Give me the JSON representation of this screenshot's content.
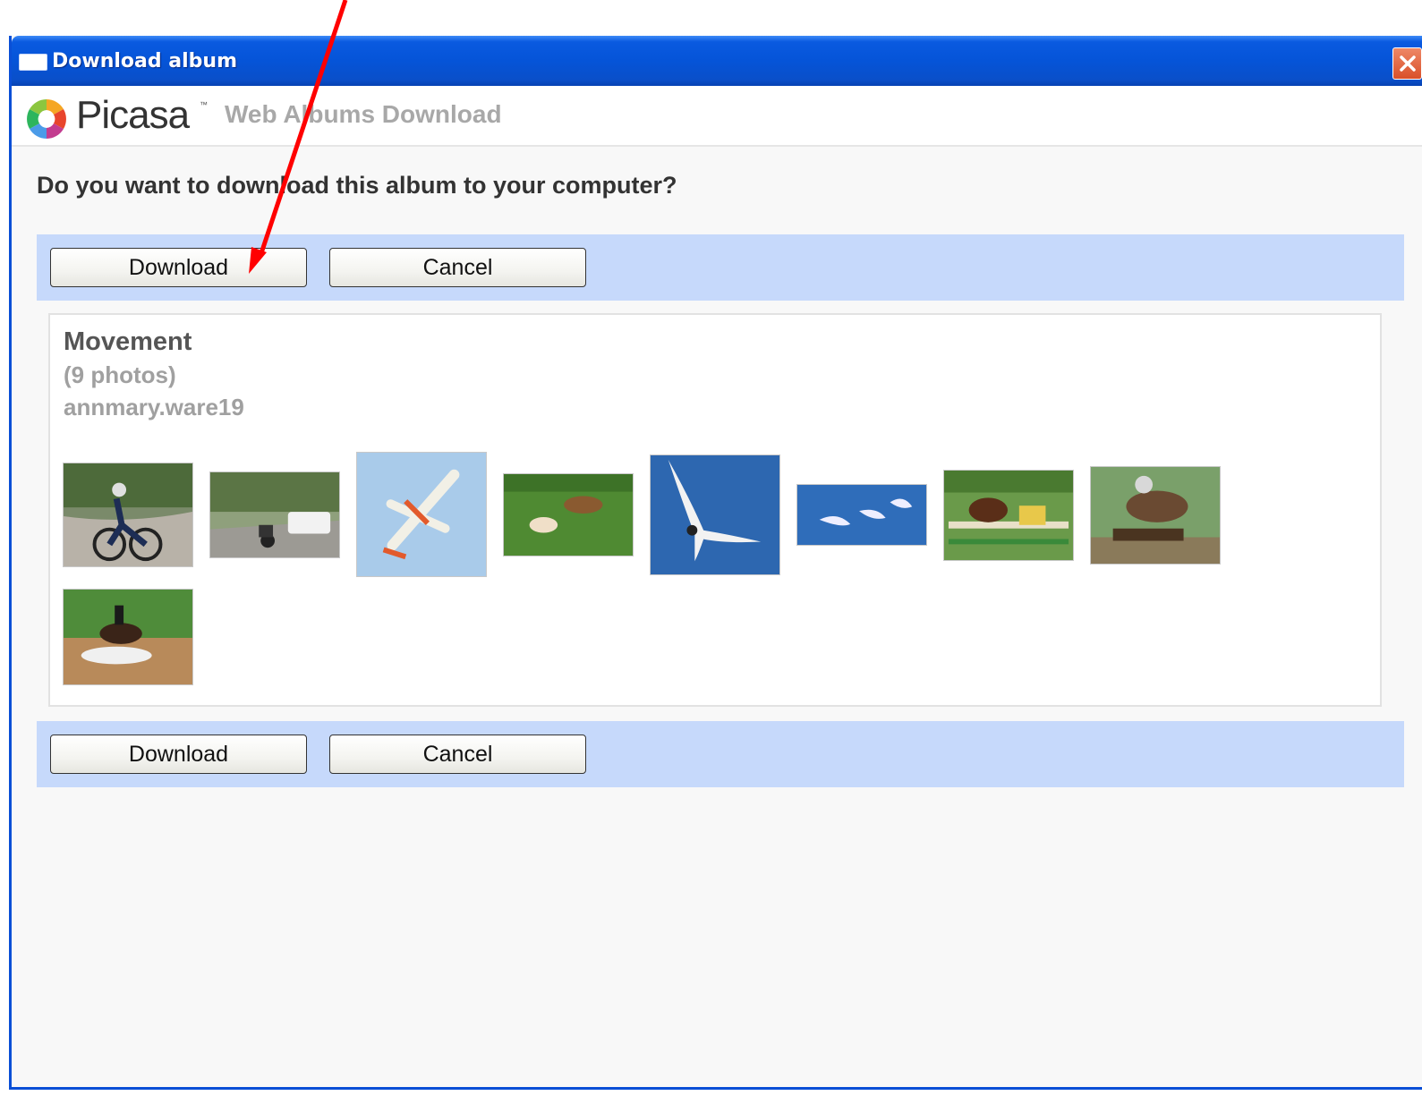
{
  "window": {
    "title": "Download album",
    "close_icon": "close-icon"
  },
  "brand": {
    "logo_icon": "picasa-logo-icon",
    "name": "Picasa",
    "trademark": "™",
    "subtitle": "Web Albums Download"
  },
  "dialog": {
    "question": "Do you want to download this album to your computer?",
    "download_label": "Download",
    "cancel_label": "Cancel"
  },
  "album": {
    "name": "Movement",
    "count": "(9 photos)",
    "owner": "annmary.ware19",
    "thumbnails": [
      {
        "subject": "cyclist"
      },
      {
        "subject": "motorbike-and-van"
      },
      {
        "subject": "airplane"
      },
      {
        "subject": "dogs-on-grass"
      },
      {
        "subject": "seagull"
      },
      {
        "subject": "birds-in-flight"
      },
      {
        "subject": "horse-show-jump"
      },
      {
        "subject": "horse-jumping-log"
      },
      {
        "subject": "horse-in-water"
      }
    ]
  },
  "annotation": {
    "arrow_color": "#ff0000",
    "target": "download-button-top"
  },
  "colors": {
    "titlebar": "#0554d8",
    "button_bar": "#c6d9fb",
    "close": "#d9502a"
  }
}
